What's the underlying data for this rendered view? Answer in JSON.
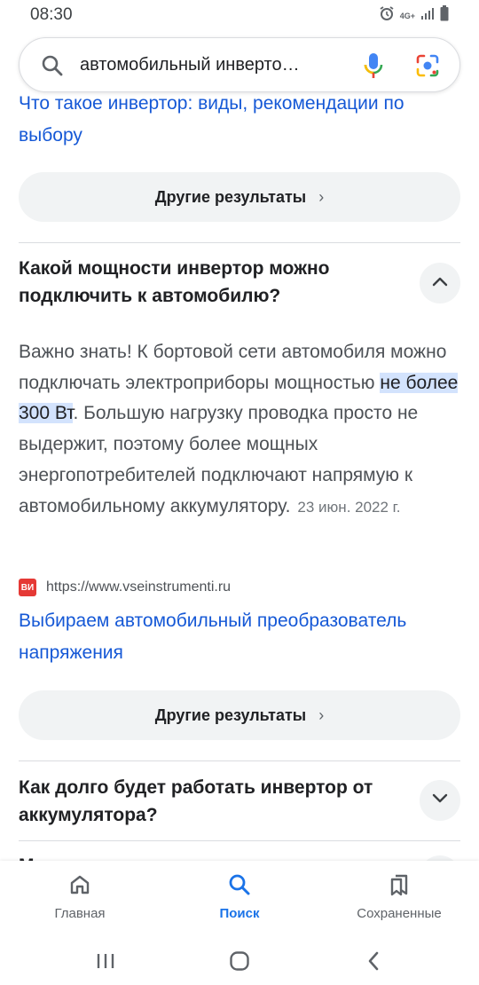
{
  "status_bar": {
    "time": "08:30",
    "network": "4G+"
  },
  "search": {
    "query": "автомобильный инверто…"
  },
  "content": {
    "prev_link": "Что такое инвертор: виды, рекомендации по выбору",
    "more_button_1": {
      "label": "Другие результаты",
      "chevron": "›"
    },
    "faq_1": {
      "question": "Какой мощности инвертор можно подключить к автомобилю?",
      "answer_before": "Важно знать! К бортовой сети автомобиля можно подключать электроприборы мощностью ",
      "answer_highlight": "не более 300 Вт",
      "answer_after": ". Большую нагрузку проводка просто не выдержит, поэтому более мощных энергопотребителей подключают напрямую к автомобильному аккумулятору.",
      "date": "23 июн. 2022 г.",
      "source_icon_text": "ВИ",
      "source_url": "https://www.vseinstrumenti.ru",
      "source_title": "Выбираем автомобильный преобразователь напряжения"
    },
    "more_button_2": {
      "label": "Другие результаты",
      "chevron": "›"
    },
    "faq_2": {
      "question": "Как долго будет работать инвертор от аккумулятора?"
    },
    "faq_3_partial": "М"
  },
  "bottom_nav": {
    "items": [
      {
        "label": "Главная",
        "icon": "home-icon"
      },
      {
        "label": "Поиск",
        "icon": "search-icon"
      },
      {
        "label": "Сохраненные",
        "icon": "bookmarks-icon"
      }
    ]
  },
  "colors": {
    "link": "#1558d6",
    "accent": "#1a73e8",
    "highlight": "#d3e3fd"
  }
}
